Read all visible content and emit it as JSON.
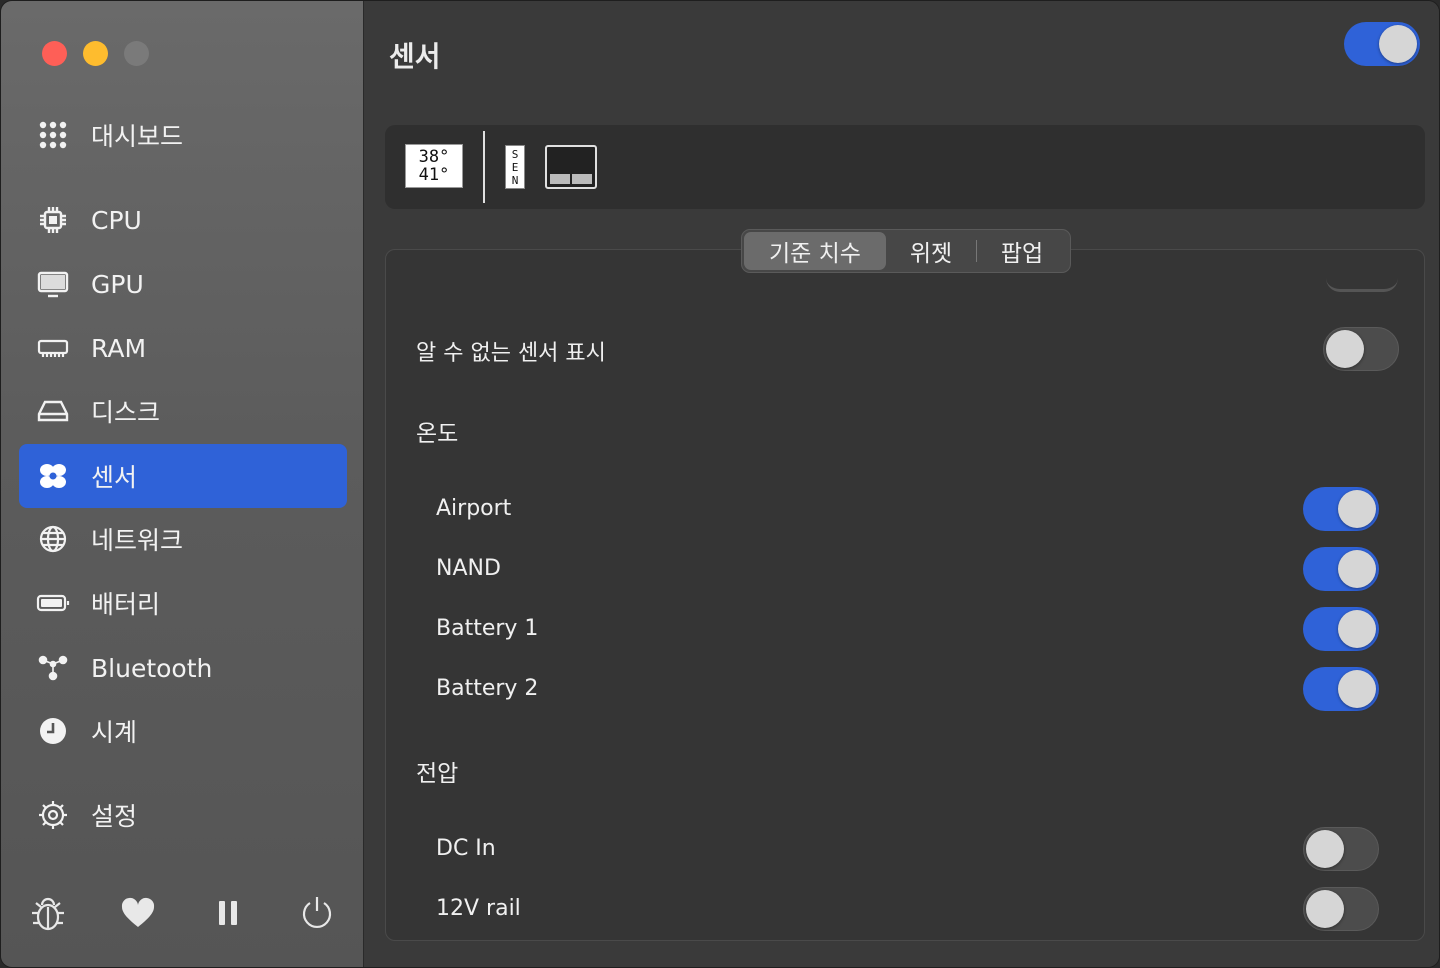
{
  "sidebar": {
    "items": [
      {
        "label": "대시보드",
        "icon": "grid-icon"
      },
      {
        "label": "CPU",
        "icon": "cpu-icon"
      },
      {
        "label": "GPU",
        "icon": "monitor-icon"
      },
      {
        "label": "RAM",
        "icon": "memory-icon"
      },
      {
        "label": "디스크",
        "icon": "disk-icon"
      },
      {
        "label": "센서",
        "icon": "fan-icon",
        "active": true
      },
      {
        "label": "네트워크",
        "icon": "globe-icon"
      },
      {
        "label": "배터리",
        "icon": "battery-icon"
      },
      {
        "label": "Bluetooth",
        "icon": "bluetooth-icon"
      },
      {
        "label": "시계",
        "icon": "clock-icon"
      },
      {
        "label": "설정",
        "icon": "gear-icon"
      }
    ],
    "bottom": [
      "bug-icon",
      "heart-icon",
      "pause-icon",
      "power-icon"
    ]
  },
  "header": {
    "title": "센서",
    "module_enabled": true
  },
  "preview": {
    "temp_line1": "38°",
    "temp_line2": "41°",
    "sen_letters": [
      "S",
      "E",
      "N"
    ]
  },
  "tabs": [
    {
      "label": "기준 치수",
      "active": true
    },
    {
      "label": "위젯",
      "active": false
    },
    {
      "label": "팝업",
      "active": false
    }
  ],
  "settings": {
    "unknown_sensors_label": "알 수 없는 센서 표시",
    "unknown_sensors_enabled": false
  },
  "sections": [
    {
      "title": "온도",
      "sensors": [
        {
          "name": "Airport",
          "enabled": true
        },
        {
          "name": "NAND",
          "enabled": true
        },
        {
          "name": "Battery 1",
          "enabled": true
        },
        {
          "name": "Battery 2",
          "enabled": true
        }
      ]
    },
    {
      "title": "전압",
      "sensors": [
        {
          "name": "DC In",
          "enabled": false
        },
        {
          "name": "12V rail",
          "enabled": false
        }
      ]
    }
  ],
  "colors": {
    "accent": "#2f62d8",
    "close": "#fe5f57",
    "minimize": "#febc2e"
  }
}
